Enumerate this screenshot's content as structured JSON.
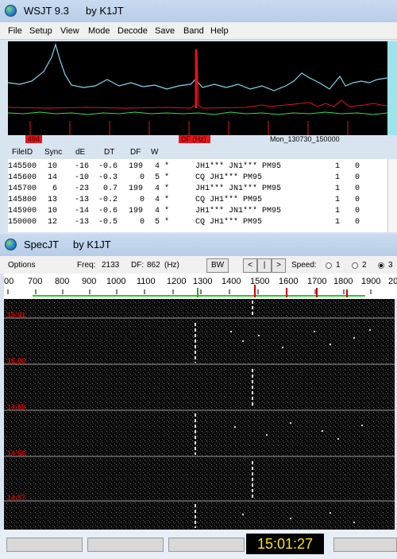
{
  "wsjt": {
    "title": "WSJT 9.3",
    "byline": "by K1JT",
    "menu": [
      "File",
      "Setup",
      "View",
      "Mode",
      "Decode",
      "Save",
      "Band",
      "Help"
    ],
    "left_marker": "494",
    "df_marker": "DF (Hz)",
    "file_date": "Mon_130730_150000",
    "columns": [
      "FileID",
      "Sync",
      "dE",
      "DT",
      "DF",
      "W"
    ],
    "decodes": [
      {
        "file": "145500",
        "sync": "10",
        "de": "-16",
        "dt": "-0.6",
        "df": "199",
        "w": "4",
        "mark": "*",
        "msg": "JH1*** JN1*** PM95",
        "c1": "1",
        "c2": "0"
      },
      {
        "file": "145600",
        "sync": "14",
        "de": "-10",
        "dt": "-0.3",
        "df": "0",
        "w": "5",
        "mark": "*",
        "msg": "CQ JH1*** PM95",
        "c1": "1",
        "c2": "0"
      },
      {
        "file": "145700",
        "sync": "6",
        "de": "-23",
        "dt": "0.7",
        "df": "199",
        "w": "4",
        "mark": "*",
        "msg": "JH1*** JN1*** PM95",
        "c1": "1",
        "c2": "0"
      },
      {
        "file": "145800",
        "sync": "13",
        "de": "-13",
        "dt": "-0.2",
        "df": "0",
        "w": "4",
        "mark": "*",
        "msg": "CQ JH1*** PM95",
        "c1": "1",
        "c2": "0"
      },
      {
        "file": "145900",
        "sync": "10",
        "de": "-14",
        "dt": "-0.6",
        "df": "199",
        "w": "4",
        "mark": "*",
        "msg": "JH1*** JN1*** PM95",
        "c1": "1",
        "c2": "0"
      },
      {
        "file": "150000",
        "sync": "12",
        "de": "-13",
        "dt": "-0.5",
        "df": "0",
        "w": "5",
        "mark": "*",
        "msg": "CQ JH1*** PM95",
        "c1": "1",
        "c2": "0"
      }
    ]
  },
  "specjt": {
    "title": "SpecJT",
    "byline": "by K1JT",
    "options_label": "Options",
    "freq_label": "Freq:",
    "freq_value": "2133",
    "df_label": "DF:",
    "df_value": "862",
    "df_unit": "(Hz)",
    "bw_label": "BW",
    "nav_left": "<",
    "nav_mid": "|",
    "nav_right": ">",
    "speed_label": "Speed:",
    "speed_options": [
      "1",
      "2",
      "3"
    ],
    "speed_selected": "3",
    "scale_labels": [
      "00",
      "700",
      "800",
      "900",
      "1000",
      "1100",
      "1200",
      "1300",
      "1400",
      "1500",
      "1600",
      "1700",
      "1800",
      "1900",
      "20"
    ],
    "time_labels": [
      "15:01",
      "15:00",
      "14:59",
      "14:58",
      "14:57"
    ],
    "clock": "15:01:27"
  }
}
